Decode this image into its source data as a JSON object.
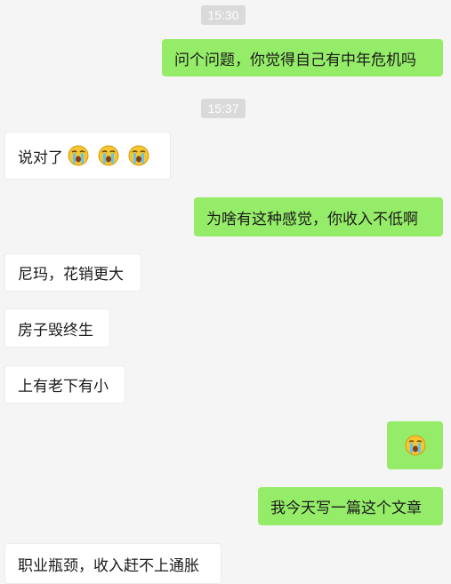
{
  "chat": {
    "messages": [
      {
        "type": "timestamp",
        "text": "15:30"
      },
      {
        "type": "sent",
        "text": "问个问题，你觉得自己有中年危机吗"
      },
      {
        "type": "timestamp",
        "text": "15:37"
      },
      {
        "type": "received",
        "text": "说对了",
        "emoji": [
          "crying-emoji",
          "crying-emoji",
          "crying-emoji"
        ]
      },
      {
        "type": "sent",
        "text": "为啥有这种感觉，你收入不低啊"
      },
      {
        "type": "received",
        "text": "尼玛，花销更大"
      },
      {
        "type": "received",
        "text": "房子毁终生"
      },
      {
        "type": "received",
        "text": "上有老下有小"
      },
      {
        "type": "sent",
        "text": "",
        "emoji": [
          "crying-emoji"
        ]
      },
      {
        "type": "sent",
        "text": "我今天写一篇这个文章"
      },
      {
        "type": "received",
        "text": "职业瓶颈，收入赶不上通胀"
      }
    ]
  },
  "colors": {
    "background": "#f5f5f5",
    "sent_bubble": "#95ec69",
    "received_bubble": "#ffffff",
    "timestamp_bg": "#dadada"
  }
}
